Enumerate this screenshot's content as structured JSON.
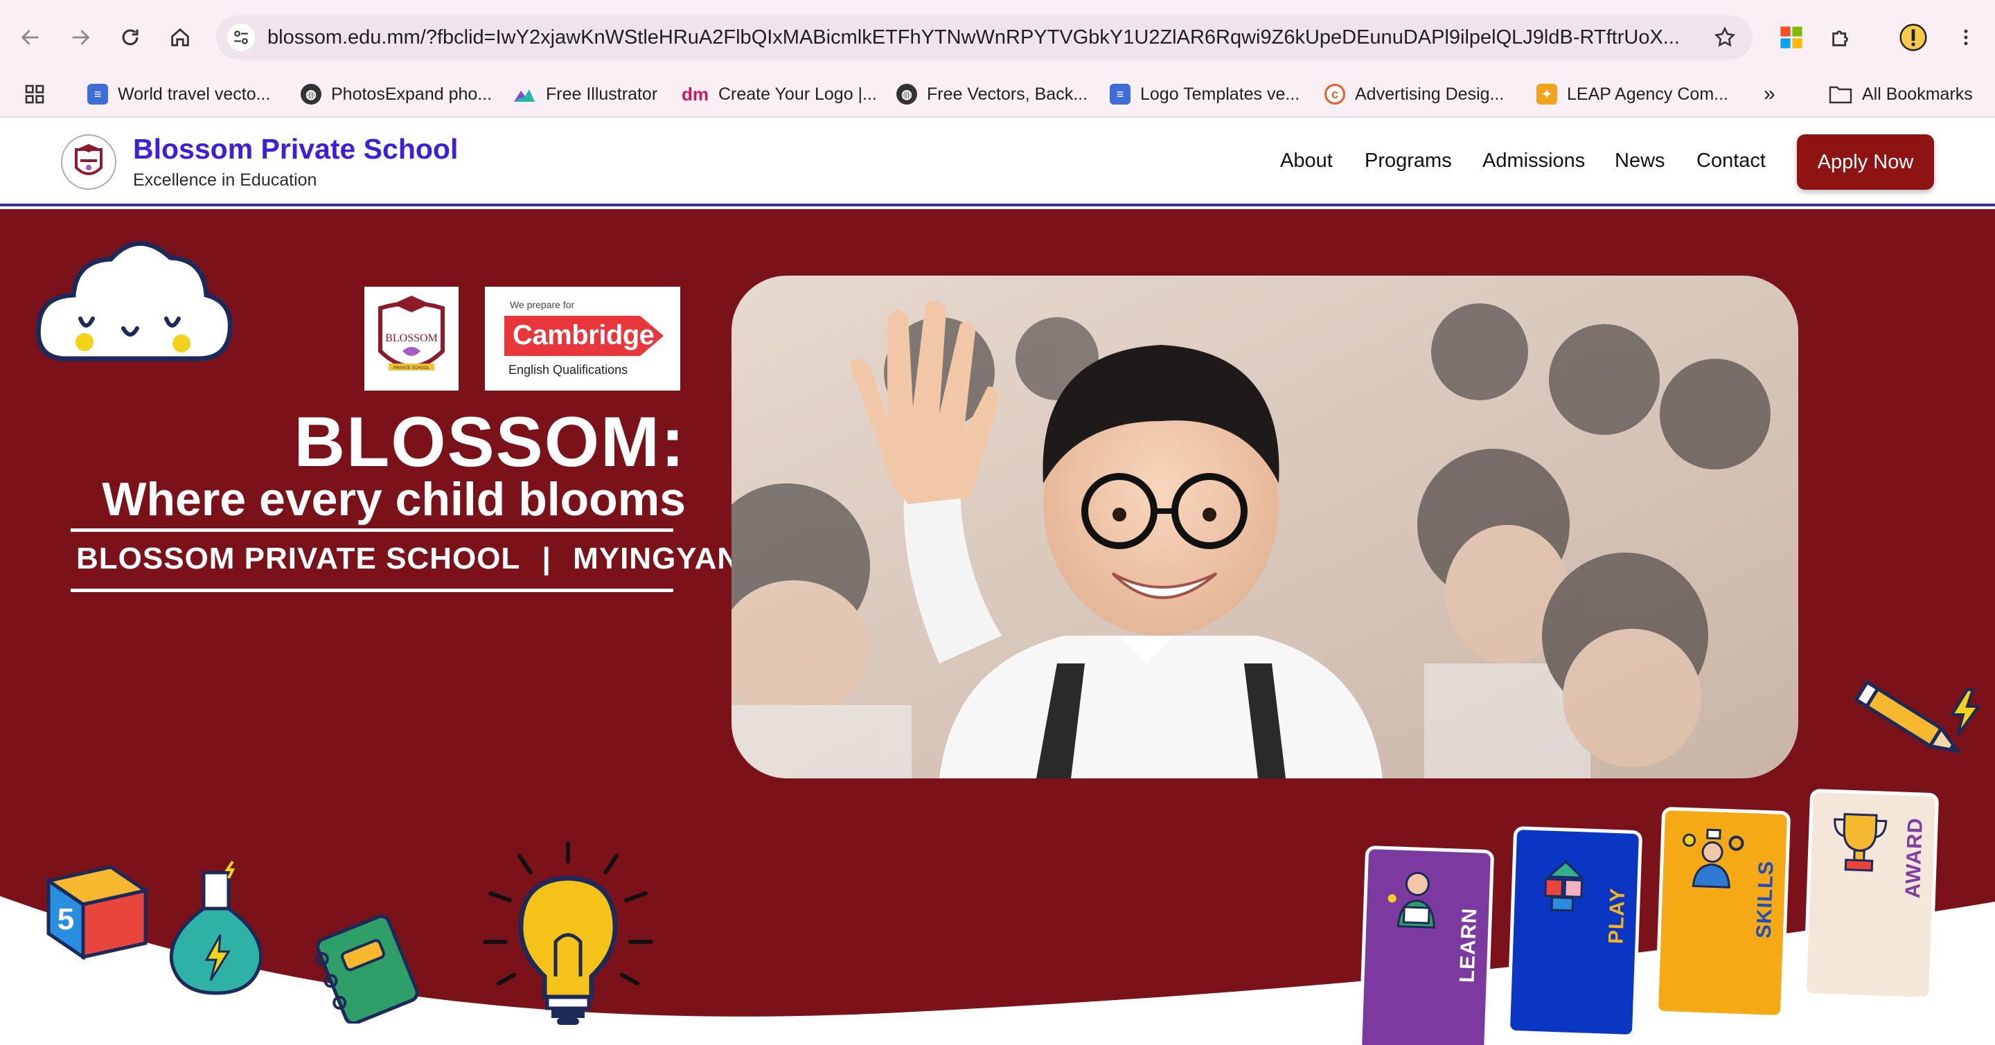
{
  "browser": {
    "url": "blossom.edu.mm/?fbclid=IwY2xjawKnWStleHRuA2FlbQIxMABicmlkETFhYTNwWnRPYTVGbkY1U2ZlAR6Rqwi9Z6kUpeDEunuDAPl9ilpelQLJ9ldB-RTftrUoX...",
    "bookmarks": [
      {
        "label": "World travel vecto...",
        "icon": "doc-blue-icon",
        "color": "#3d6dd8"
      },
      {
        "label": "PhotosExpand pho...",
        "icon": "globe-icon",
        "color": "#333333"
      },
      {
        "label": "Free Illustrator",
        "icon": "mountain-icon",
        "color": "#1fb9a6"
      },
      {
        "label": "Create Your Logo |...",
        "icon": "dm-logo-icon",
        "color": "#d4145a"
      },
      {
        "label": "Free Vectors, Back...",
        "icon": "globe-icon",
        "color": "#333333"
      },
      {
        "label": "Logo Templates ve...",
        "icon": "doc-blue-icon",
        "color": "#3d6dd8"
      },
      {
        "label": "Advertising Desig...",
        "icon": "c-orange-icon",
        "color": "#f05a24"
      },
      {
        "label": "LEAP Agency Com...",
        "icon": "puzzle-icon",
        "color": "#f2a31b"
      }
    ],
    "more": "»",
    "all_bookmarks": "All Bookmarks"
  },
  "site": {
    "brand_name": "Blossom Private School",
    "tagline": "Excellence in Education",
    "nav": [
      "About",
      "Programs",
      "Admissions",
      "News",
      "Contact"
    ],
    "apply": "Apply Now",
    "colors": {
      "brand": "#3b1fe0",
      "maroon": "#7b121a",
      "apply": "#8e1413"
    }
  },
  "hero": {
    "badge_school": "BLOSSOM",
    "badge_school_sub": "PRIVATE SCHOOL",
    "cambridge_prep": "We prepare for",
    "cambridge_word": "Cambridge",
    "cambridge_sub": "English Qualifications",
    "title": "BLOSSOM:",
    "subtitle": "Where every child blooms",
    "school": "BLOSSOM PRIVATE SCHOOL",
    "separator": "|",
    "city": "MYINGYAN",
    "cards": [
      {
        "label": "LEARN",
        "color": "#7c3aa0",
        "label_color": "#ffffff"
      },
      {
        "label": "PLAY",
        "color": "#0b36c4",
        "label_color": "#f4b41a"
      },
      {
        "label": "SKILLS",
        "color": "#f5a914",
        "label_color": "#1f4fbf"
      },
      {
        "label": "AWARD",
        "color": "#f4e6d8",
        "label_color": "#7b3ea3"
      }
    ],
    "cube_number": "5"
  }
}
